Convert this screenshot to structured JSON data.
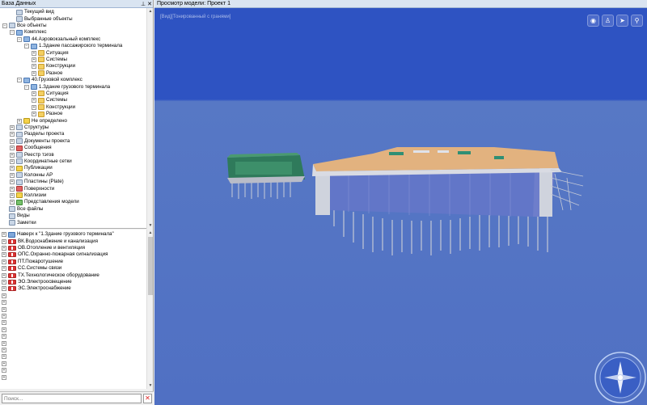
{
  "left_panel": {
    "title": "База Данных",
    "pin_icon": "pin-icon",
    "close_icon": "close-icon",
    "tree": [
      {
        "label": "Текущий вид",
        "indent": 1,
        "icon": "gen",
        "exp": ""
      },
      {
        "label": "Выбранные объекты",
        "indent": 1,
        "icon": "gen",
        "exp": ""
      },
      {
        "label": "Все объекты",
        "indent": 0,
        "icon": "gen",
        "exp": "−"
      },
      {
        "label": "Комплекс",
        "indent": 1,
        "icon": "build",
        "exp": "−"
      },
      {
        "label": "44.Аэровокзальный комплекс",
        "indent": 2,
        "icon": "build",
        "exp": "−"
      },
      {
        "label": "1.Здание пассажирского терминала",
        "indent": 3,
        "icon": "build",
        "exp": "−"
      },
      {
        "label": "Ситуация",
        "indent": 4,
        "icon": "folder",
        "exp": "+"
      },
      {
        "label": "Системы",
        "indent": 4,
        "icon": "folder",
        "exp": "+"
      },
      {
        "label": "Конструкции",
        "indent": 4,
        "icon": "folder",
        "exp": "+"
      },
      {
        "label": "Разное",
        "indent": 4,
        "icon": "folder",
        "exp": "+"
      },
      {
        "label": "40.Грузовой комплекс",
        "indent": 2,
        "icon": "build",
        "exp": "−"
      },
      {
        "label": "1.Здание грузового терминала",
        "indent": 3,
        "icon": "build",
        "exp": "−"
      },
      {
        "label": "Ситуация",
        "indent": 4,
        "icon": "folder",
        "exp": "+"
      },
      {
        "label": "Системы",
        "indent": 4,
        "icon": "folder",
        "exp": "+"
      },
      {
        "label": "Конструкции",
        "indent": 4,
        "icon": "folder",
        "exp": "+"
      },
      {
        "label": "Разное",
        "indent": 4,
        "icon": "folder",
        "exp": "+"
      },
      {
        "label": "Не определено",
        "indent": 2,
        "icon": "yel",
        "exp": "+"
      },
      {
        "label": "Структуры",
        "indent": 1,
        "icon": "gen",
        "exp": "+"
      },
      {
        "label": "Разделы проекта",
        "indent": 1,
        "icon": "gen",
        "exp": "+"
      },
      {
        "label": "Документы проекта",
        "indent": 1,
        "icon": "gen",
        "exp": "+"
      },
      {
        "label": "Сообщения",
        "indent": 1,
        "icon": "red",
        "exp": "+"
      },
      {
        "label": "Реестр тэгов",
        "indent": 1,
        "icon": "gen",
        "exp": "+"
      },
      {
        "label": "Координатные сетки",
        "indent": 1,
        "icon": "gen",
        "exp": "+"
      },
      {
        "label": "Публикации",
        "indent": 1,
        "icon": "yel",
        "exp": "+"
      },
      {
        "label": "Колонны АР",
        "indent": 1,
        "icon": "gen",
        "exp": "+"
      },
      {
        "label": "Пластины (Plate)",
        "indent": 1,
        "icon": "gen",
        "exp": "+"
      },
      {
        "label": "Поверхности",
        "indent": 1,
        "icon": "red",
        "exp": "+"
      },
      {
        "label": "Коллизии",
        "indent": 1,
        "icon": "yel",
        "exp": "+"
      },
      {
        "label": "Представления модели",
        "indent": 1,
        "icon": "grn",
        "exp": "+"
      },
      {
        "label": "Все файлы",
        "indent": 0,
        "icon": "gen",
        "exp": ""
      },
      {
        "label": "Виды",
        "indent": 0,
        "icon": "gen",
        "exp": ""
      },
      {
        "label": "Заметки",
        "indent": 0,
        "icon": "gen",
        "exp": ""
      }
    ],
    "list": [
      {
        "label": "Наверх к \"1.Здание грузового терминала\"",
        "icon": "nav"
      },
      {
        "label": "ВК.Водоснабжение и канализация",
        "icon": "sys"
      },
      {
        "label": "ОВ.Отопление и вентиляция",
        "icon": "sys"
      },
      {
        "label": "ОПС.Охранно-пожарная сигнализация",
        "icon": "sys"
      },
      {
        "label": "ПТ.Пожаротушение",
        "icon": "sys"
      },
      {
        "label": "СС.Системы связи",
        "icon": "sys"
      },
      {
        "label": "ТХ.Технологическое оборудование",
        "icon": "sys"
      },
      {
        "label": "ЭО.Электроосвещение",
        "icon": "sys"
      },
      {
        "label": "ЭС.Электроснабжение",
        "icon": "sys"
      }
    ],
    "search_placeholder": "Поиск..."
  },
  "viewer": {
    "title": "Просмотр модели: Проект 1",
    "view_label": "[Вид][Тонированный с гранями]",
    "toolbar": [
      "eye-icon",
      "person-icon",
      "plane-icon",
      "walk-icon"
    ],
    "colors": {
      "sky": "#2e53c2",
      "ground": "#5070c3",
      "roof": "#e2b27f",
      "glass": "#6276c8"
    }
  }
}
